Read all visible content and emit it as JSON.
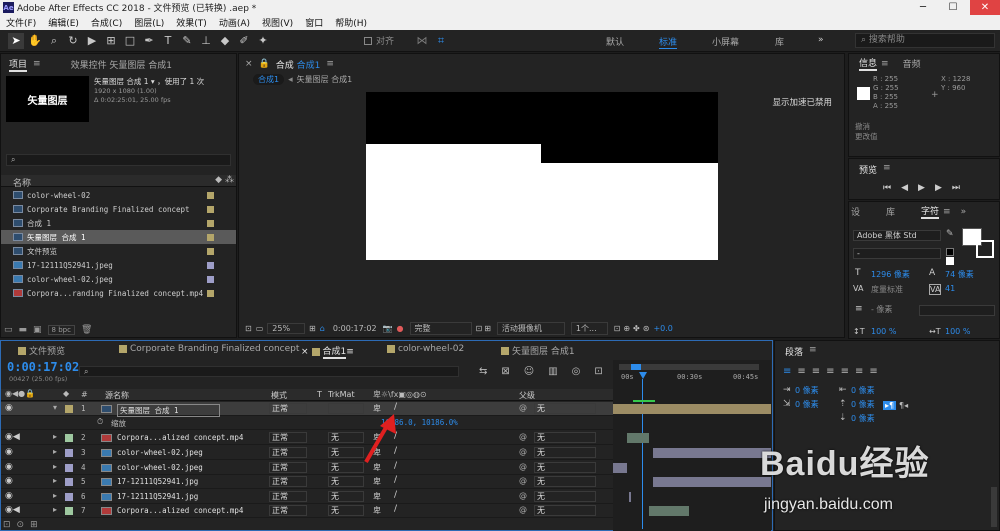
{
  "title": "Adobe After Effects CC 2018 - 文件预览 (已转换) .aep *",
  "window_controls": [
    "─",
    "☐",
    "✕"
  ],
  "menu": [
    "文件(F)",
    "编辑(E)",
    "合成(C)",
    "图层(L)",
    "效果(T)",
    "动画(A)",
    "视图(V)",
    "窗口",
    "帮助(H)"
  ],
  "toolbar": {
    "align_label": "对齐",
    "workspaces": [
      "默认",
      "标准",
      "小屏幕",
      "库"
    ],
    "search_placeholder": "搜索帮助"
  },
  "project": {
    "tab_project": "项目",
    "tab_effects": "效果控件 矢量图层 合成1",
    "thumb_label": "矢量图层",
    "info_name": "矢量图层 合成 1 ▾ ，使用了 1 次",
    "info_size": "1920 x 1080 (1.00)",
    "info_duration": "Δ 0:02:25:01, 25.00 fps",
    "col_name": "名称",
    "items": [
      {
        "name": "color-wheel-02",
        "type": "comp",
        "color": "#b4a66a"
      },
      {
        "name": "Corporate Branding  Finalized concept",
        "type": "comp",
        "color": "#b4a66a"
      },
      {
        "name": "合成 1",
        "type": "comp",
        "color": "#b4a66a"
      },
      {
        "name": "矢量图层 合成 1",
        "type": "comp",
        "color": "#b4a66a",
        "selected": true
      },
      {
        "name": "文件预览",
        "type": "comp",
        "color": "#b4a66a"
      },
      {
        "name": "17-12111Q52941.jpeg",
        "type": "image",
        "color": "#9e9ec8"
      },
      {
        "name": "color-wheel-02.jpeg",
        "type": "image",
        "color": "#9e9ec8"
      },
      {
        "name": "Corpora...randing  Finalized concept.mp4",
        "type": "video",
        "color": "#b4a66a"
      }
    ],
    "bpc": "8 bpc"
  },
  "composition": {
    "tab": "合成",
    "comp_name": "合成1",
    "breadcrumb_1": "合成1",
    "breadcrumb_2": "矢量图层 合成1",
    "accel_notice": "显示加速已禁用",
    "zoom": "25%",
    "timecode": "0:00:17:02",
    "quality": "完整",
    "camera": "活动摄像机",
    "views": "1个...",
    "exposure": "+0.0"
  },
  "info": {
    "tab": "信息",
    "tab2": "音频",
    "r": "R : 255",
    "g": "G : 255",
    "b": "B : 255",
    "a": "A : 255",
    "x": "X : 1228",
    "y": "Y : 960",
    "line1": "撤消",
    "line2": "更改值"
  },
  "preview": {
    "tab": "预览"
  },
  "character": {
    "tabs": [
      "设",
      "库",
      "字符"
    ],
    "font": "Adobe 黑体 Std",
    "style": "-",
    "size": "1296 像素",
    "leading": "74 像素",
    "kerning": "度量标准",
    "tracking": "41",
    "stroke": "- 像素",
    "scale_v": "100 %",
    "scale_h": "100 %"
  },
  "paragraph": {
    "tab": "段落",
    "indent_left": "0 像素",
    "indent_right": "0 像素",
    "indent_first": "0 像素",
    "space_before": "0 像素",
    "space_after": "0 像素"
  },
  "timeline": {
    "tabs": [
      "文件预览",
      "Corporate Branding  Finalized concept",
      "合成1",
      "color-wheel-02",
      "矢量图层 合成1"
    ],
    "tab_colors": [
      "#b4a66a",
      "#b4a66a",
      "#b4a66a",
      "#b4a66a",
      "#b4a66a"
    ],
    "timecode": "0:00:17:02",
    "frames": "00427 (25.00 fps)",
    "headers": {
      "num": "#",
      "name": "源名称",
      "mode": "模式",
      "t": "T",
      "trkmat": "TrkMat",
      "parent": "父级"
    },
    "ruler": [
      "00s",
      "00:30s",
      "00:45s"
    ],
    "property": {
      "name": "缩放",
      "value": "10186.0, 10186.0%"
    },
    "layers": [
      {
        "num": "1",
        "name": "矢量图层 合成 1",
        "mode": "正常",
        "trkmat": "",
        "parent": "无",
        "color": "#b4a66a",
        "icon": "comp"
      },
      {
        "num": "2",
        "name": "Corpora...alized concept.mp4",
        "mode": "正常",
        "trkmat": "无",
        "parent": "无",
        "color": "#9ec8a0",
        "icon": "video"
      },
      {
        "num": "3",
        "name": "color-wheel-02.jpeg",
        "mode": "正常",
        "trkmat": "无",
        "parent": "无",
        "color": "#9e9ec8",
        "icon": "image"
      },
      {
        "num": "4",
        "name": "color-wheel-02.jpeg",
        "mode": "正常",
        "trkmat": "无",
        "parent": "无",
        "color": "#9e9ec8",
        "icon": "image"
      },
      {
        "num": "5",
        "name": "17-12111Q52941.jpg",
        "mode": "正常",
        "trkmat": "无",
        "parent": "无",
        "color": "#9e9ec8",
        "icon": "image"
      },
      {
        "num": "6",
        "name": "17-12111Q52941.jpg",
        "mode": "正常",
        "trkmat": "无",
        "parent": "无",
        "color": "#9e9ec8",
        "icon": "image"
      },
      {
        "num": "7",
        "name": "Corpora...alized concept.mp4",
        "mode": "正常",
        "trkmat": "无",
        "parent": "无",
        "color": "#9ec8a0",
        "icon": "video"
      }
    ]
  },
  "watermark": {
    "brand": "Baidu经验",
    "url": "jingyan.baidu.com"
  }
}
